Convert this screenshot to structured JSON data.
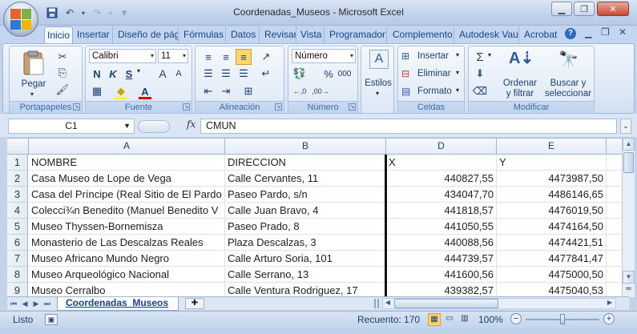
{
  "window": {
    "title": "Coordenadas_Museos - Microsoft Excel",
    "controls": [
      "minimize-icon",
      "restore-icon",
      "close-icon"
    ]
  },
  "ribbon_tabs": [
    "Inicio",
    "Insertar",
    "Diseño de pág",
    "Fórmulas",
    "Datos",
    "Revisar",
    "Vista",
    "Programador",
    "Complemento",
    "Autodesk Vau",
    "Acrobat"
  ],
  "clipboard": {
    "paste": "Pegar",
    "label": "Portapapeles"
  },
  "font": {
    "name": "Calibri",
    "size": "11",
    "bold": "N",
    "italic": "K",
    "underline": "S",
    "grow": "A",
    "shrink": "A",
    "color_letter": "A",
    "label": "Fuente"
  },
  "alignment": {
    "label": "Alineación"
  },
  "number": {
    "format": "Número",
    "percent": "%",
    "thousands": "000",
    "label": "Número"
  },
  "styles": {
    "button": "Estilos"
  },
  "cells": {
    "insert": "Insertar",
    "delete": "Eliminar",
    "format": "Formato",
    "label": "Celdas"
  },
  "editing": {
    "sigma": "Σ",
    "sort_line1": "Ordenar",
    "sort_line2": "y filtrar",
    "find_line1": "Buscar y",
    "find_line2": "seleccionar",
    "label": "Modificar"
  },
  "formula_bar": {
    "name_box": "C1",
    "fx": "fx",
    "content": "CMUN"
  },
  "columns": [
    "A",
    "B",
    "D",
    "E"
  ],
  "rows": [
    {
      "n": "1",
      "a": "NOMBRE",
      "b": "DIRECCION",
      "d": "X",
      "e": "Y"
    },
    {
      "n": "2",
      "a": "Casa Museo de Lope de Vega",
      "b": "Calle Cervantes, 11",
      "d": "440827,55",
      "e": "4473987,50"
    },
    {
      "n": "3",
      "a": "Casa del Príncipe (Real Sitio de El Pardo",
      "b": "Paseo Pardo, s/n",
      "d": "434047,70",
      "e": "4486146,65"
    },
    {
      "n": "4",
      "a": "Colecci¾n Benedito (Manuel Benedito V",
      "b": "Calle Juan Bravo, 4",
      "d": "441818,57",
      "e": "4476019,50"
    },
    {
      "n": "5",
      "a": "Museo Thyssen-Bornemisza",
      "b": "Paseo Prado, 8",
      "d": "441050,55",
      "e": "4474164,50"
    },
    {
      "n": "6",
      "a": "Monasterio de Las Descalzas Reales",
      "b": "Plaza Descalzas, 3",
      "d": "440088,56",
      "e": "4474421,51"
    },
    {
      "n": "7",
      "a": "Museo Africano Mundo Negro",
      "b": "Calle Arturo Soria, 101",
      "d": "444739,57",
      "e": "4477841,47"
    },
    {
      "n": "8",
      "a": "Museo Arqueológico Nacional",
      "b": "Calle Serrano, 13",
      "d": "441600,56",
      "e": "4475000,50"
    },
    {
      "n": "9",
      "a": "Museo Cerralbo",
      "b": "Calle Ventura Rodriguez, 17",
      "d": "439382,57",
      "e": "4475040,53"
    }
  ],
  "sheet": {
    "tab": "Coordenadas_Museos"
  },
  "status": {
    "ready": "Listo",
    "count": "Recuento: 170",
    "zoom": "100%"
  }
}
